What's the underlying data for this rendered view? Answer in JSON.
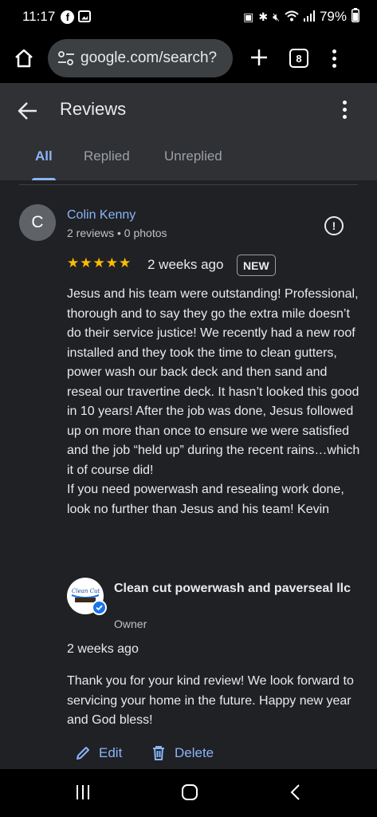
{
  "status_bar": {
    "time": "11:17",
    "battery": "79%"
  },
  "browser": {
    "url": "google.com/search?",
    "tab_count": "8"
  },
  "header": {
    "title": "Reviews",
    "tabs": [
      {
        "label": "All",
        "active": true
      },
      {
        "label": "Replied",
        "active": false
      },
      {
        "label": "Unreplied",
        "active": false
      }
    ]
  },
  "review": {
    "avatar_letter": "C",
    "name": "Colin Kenny",
    "meta": "2 reviews • 0 photos",
    "rating": 5,
    "stars": "★★★★★",
    "time": "2 weeks ago",
    "badge": "NEW",
    "text": "Jesus and his team were outstanding! Professional, thorough and to say they go the extra mile doesn’t do their service justice! We recently had a new roof installed and they took the time to clean gutters, power wash our back deck and then sand and reseal our travertine deck. It hasn’t looked this good in 10 years! After the job was done, Jesus followed up on more than once to ensure we were satisfied and the job “held up” during the recent rains…which it of course did!\nIf you need powerwash and resealing work done, look no further than Jesus and his team! Kevin"
  },
  "reply": {
    "owner_name": "Clean cut powerwash and paverseal llc",
    "role": "Owner",
    "time": "2 weeks ago",
    "text": "Thank you for your kind review! We look forward to servicing your home in the future. Happy new year and God bless!",
    "edit_label": "Edit",
    "delete_label": "Delete"
  },
  "colors": {
    "accent": "#8ab4f8",
    "star": "#fbbc04",
    "background": "#202124"
  }
}
